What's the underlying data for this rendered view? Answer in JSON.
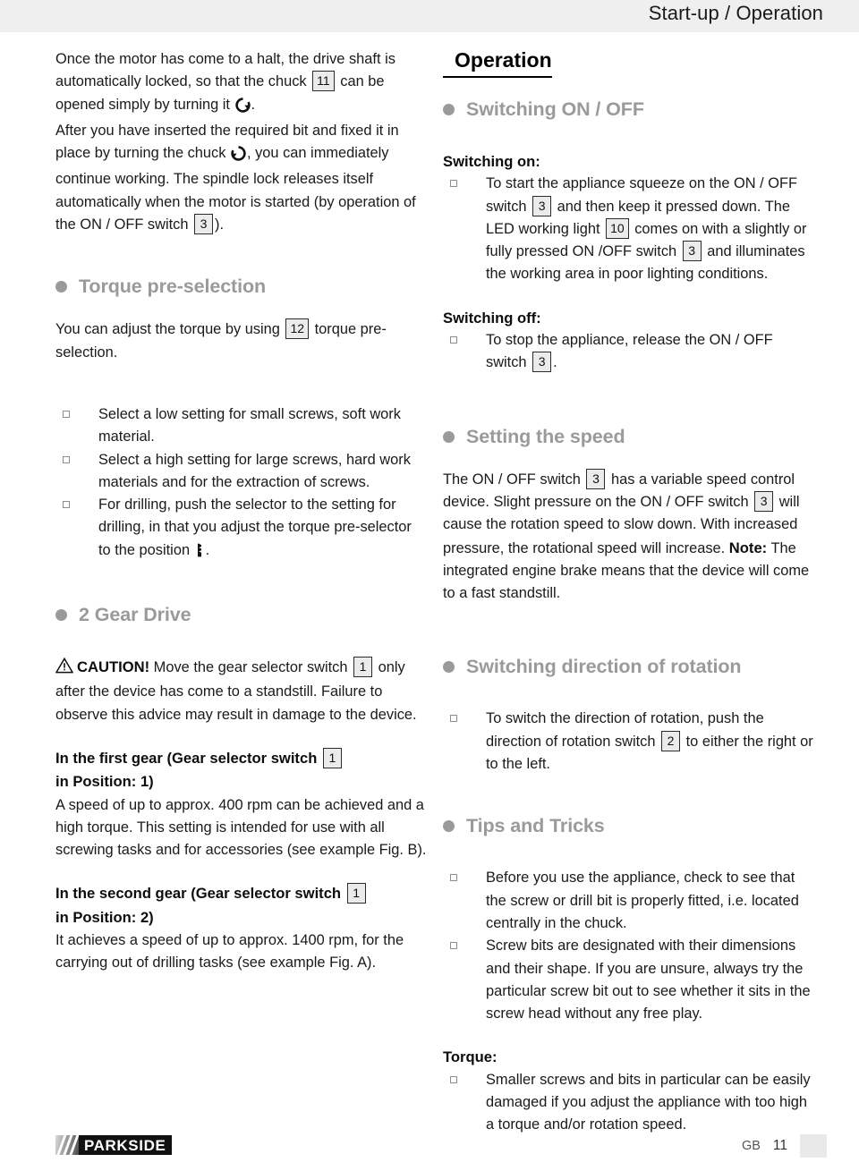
{
  "header": {
    "title": "Start-up / Operation",
    "background_color": "#efefef"
  },
  "colors": {
    "heading_gray": "#9a9a9a",
    "heading_black": "#000000",
    "refbox_fill": "#ebebeb",
    "refbox_border": "#2b2b2b",
    "bullet_square_border": "#8d8d8d",
    "body_text": "#1a1a1a"
  },
  "left_column": {
    "intro_para_1": {
      "seg1": "Once the motor has come to a halt, the drive shaft is automatically locked, so that the chuck ",
      "ref1": "11",
      "seg2": " can be opened simply by turning it ",
      "icon": "rotate-clockwise-icon",
      "seg3": "."
    },
    "intro_para_2": {
      "seg1": "After you have inserted the required bit and fixed it in place by turning the chuck ",
      "icon": "rotate-counterclockwise-icon",
      "seg2": ", you can immediately continue working. The spindle lock releases itself automatically when the motor is started (by operation of the ON / OFF switch ",
      "ref1": "3",
      "seg3": ")."
    },
    "torque_heading": "Torque pre-selection",
    "torque_para": {
      "seg1": "You can adjust the torque by using ",
      "ref1": "12",
      "seg2": " torque pre-selection."
    },
    "torque_bullets": [
      {
        "text": "Select a low setting for small screws, soft work material."
      },
      {
        "text": "Select a high setting for large screws, hard work materials and for the extraction of screws."
      },
      {
        "seg1": "For drilling, push the selector to the setting for drilling, in that you adjust the torque pre-selector to the position ",
        "icon": "drill-bit-icon",
        "seg2": "."
      }
    ],
    "gear_heading": "2 Gear Drive",
    "caution": {
      "icon": "warning-triangle-icon",
      "label": "CAUTION!",
      "seg1": " Move the gear selector switch ",
      "ref1": "1",
      "seg2": " only after the device has come to a standstill. Failure to observe this advice may result in damage to the device."
    },
    "first_gear": {
      "heading_seg1": "In the first gear (Gear selector switch ",
      "heading_ref": "1",
      "heading_seg2": "in Position: 1)",
      "body": "A speed of up to approx. 400 rpm can be achieved and a high torque. This setting is intended for use with all screwing tasks and for accessories (see example Fig. B)."
    },
    "second_gear": {
      "heading_seg1": "In the second gear (Gear selector switch ",
      "heading_ref": "1",
      "heading_seg2": "in Position: 2)",
      "body": "It achieves a speed of up to approx. 1400 rpm, for the carrying out of drilling tasks (see example Fig. A)."
    }
  },
  "right_column": {
    "operation_heading": "Operation",
    "switching_heading": "Switching ON / OFF",
    "switching_on_label": "Switching on:",
    "switching_on_bullet": {
      "seg1": "To start the appliance squeeze on the ON / OFF switch ",
      "ref1": "3",
      "seg2": " and then keep it pressed down. The LED working light ",
      "ref2": "10",
      "seg3": " comes on with a slightly or fully pressed ON /OFF switch ",
      "ref3": "3",
      "seg4": " and illuminates the working area in poor lighting conditions."
    },
    "switching_off_label": "Switching off:",
    "switching_off_bullet": {
      "seg1": "To stop the appliance, release the ON / OFF switch ",
      "ref1": "3",
      "seg2": "."
    },
    "speed_heading": "Setting the speed",
    "speed_para": {
      "seg1": "The ON / OFF switch ",
      "ref1": "3",
      "seg2": " has a variable speed control device. Slight pressure on the ON / OFF switch ",
      "ref2": "3",
      "seg3": " will cause the rotation speed to slow down. With increased pressure, the rotational speed will increase. ",
      "note_label": "Note:",
      "seg4": " The integrated engine brake means that the device will come to a fast standstill."
    },
    "rotation_heading": "Switching direction of rotation",
    "rotation_bullet": {
      "seg1": "To switch the direction of rotation, push the direction of rotation switch ",
      "ref1": "2",
      "seg2": " to either the right or to the left."
    },
    "tips_heading": "Tips and Tricks",
    "tips_bullets": [
      {
        "text": "Before you use the appliance, check to see that the screw or drill bit is properly fitted, i.e. located centrally in the chuck."
      },
      {
        "text": "Screw bits are designated with their dimensions and their shape. If you are unsure, always try the particular screw bit out to see whether it sits in the screw head without any free play."
      }
    ],
    "torque_label": "Torque:",
    "torque_bullet": {
      "text": "Smaller screws and bits in particular can be easily damaged if you adjust the appliance with too high a torque and/or rotation speed."
    }
  },
  "footer": {
    "brand": "PARKSIDE",
    "country_code": "GB",
    "page_number": "11"
  }
}
